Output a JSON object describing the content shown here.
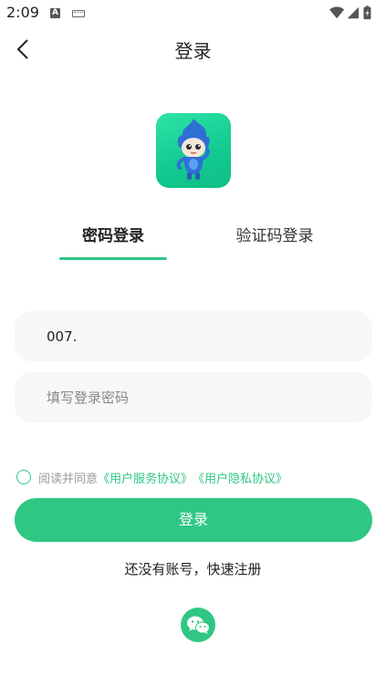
{
  "status_bar": {
    "time": "2:09",
    "icons": [
      "a-notification-icon",
      "keyboard-icon",
      "wifi-icon",
      "signal-icon",
      "battery-charging-icon"
    ]
  },
  "header": {
    "title": "登录",
    "back_icon": "chevron-left-icon"
  },
  "logo": {
    "icon": "mascot-icon"
  },
  "tabs": [
    {
      "label": "密码登录",
      "active": true
    },
    {
      "label": "验证码登录",
      "active": false
    }
  ],
  "form": {
    "account_value": "007.",
    "password_placeholder": "填写登录密码"
  },
  "agreement": {
    "prefix": "阅读并同意",
    "service_link": "《用户服务协议》",
    "privacy_link": "《用户隐私协议》",
    "checked": false
  },
  "login_button": {
    "label": "登录"
  },
  "register_link": {
    "label": "还没有账号，快速注册"
  },
  "wechat_login": {
    "icon": "wechat-icon"
  },
  "colors": {
    "accent": "#2fc783",
    "input_bg": "#f7f7f7",
    "muted_text": "#999999"
  }
}
